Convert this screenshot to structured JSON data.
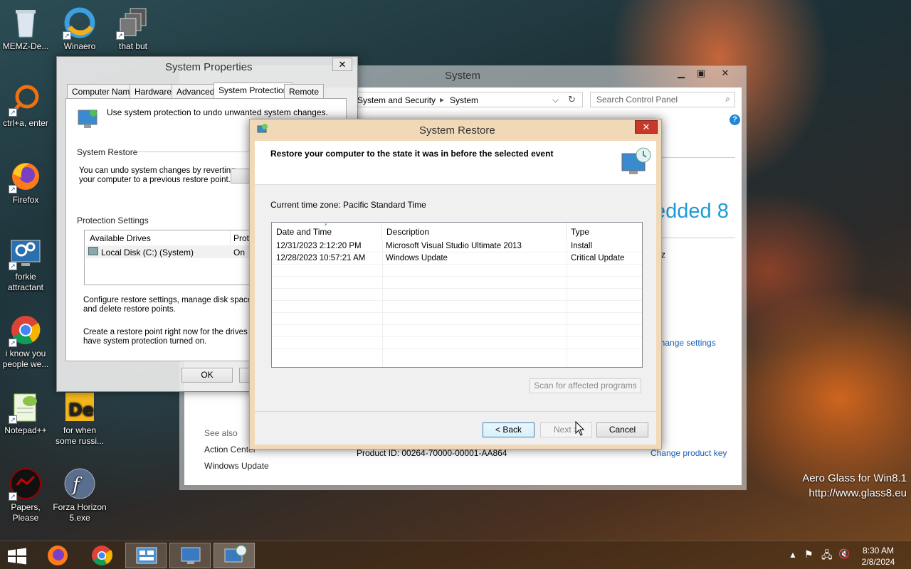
{
  "desktop": {
    "icons": [
      {
        "label": "MEMZ-De...",
        "icon": "recycle-bin-icon"
      },
      {
        "label": "Winaero Tweaker",
        "icon": "winaero-icon"
      },
      {
        "label": "that but ",
        "icon": "stack-icon"
      },
      {
        "label": "ctrl+a, enter",
        "icon": "orange-ring-icon"
      },
      {
        "label": "Firefox",
        "icon": "firefox-icon"
      },
      {
        "label": "forkie attractant",
        "icon": "gears-monitor-icon"
      },
      {
        "label": "i know you people we...",
        "icon": "chrome-icon"
      },
      {
        "label": "Notepad++",
        "icon": "notepadpp-icon"
      },
      {
        "label": "for when some russi...",
        "icon": "de-icon"
      },
      {
        "label": "Papers, Please",
        "icon": "papers-please-icon"
      },
      {
        "label": "Forza Horizon 5.exe",
        "icon": "flash-icon"
      }
    ],
    "watermark_line1": "Aero Glass for Win8.1",
    "watermark_line2": "http://www.glass8.eu"
  },
  "system_window": {
    "title": "System",
    "breadcrumb_1": "System and Security",
    "breadcrumb_sep": "▸",
    "breadcrumb_2": "System",
    "search_placeholder": "Search Control Panel",
    "edition_fragment": "edded 8",
    "z_fragment": "z",
    "change_settings": "Change settings",
    "see_also": "See also",
    "action_center": "Action Center",
    "windows_update": "Windows Update",
    "product_id": "Product ID:  00264-70000-00001-AA864",
    "change_product_key": "Change product key"
  },
  "properties_window": {
    "title": "System Properties",
    "tabs": [
      "Computer Name",
      "Hardware",
      "Advanced",
      "System Protection",
      "Remote"
    ],
    "intro": "Use system protection to undo unwanted system changes.",
    "restore_group": "System Restore",
    "restore_text_1": "You can undo system changes by reverting",
    "restore_text_2": "your computer to a previous restore point.",
    "protection_group": "Protection Settings",
    "col_drives": "Available Drives",
    "col_protection": "Prote",
    "drive_name": "Local Disk (C:) (System)",
    "drive_status": "On",
    "configure_text_1": "Configure restore settings, manage disk space,",
    "configure_text_2": "and delete restore points.",
    "create_text_1": "Create a restore point right now for the drives that",
    "create_text_2": "have system protection turned on.",
    "ok_label": "OK"
  },
  "restore_window": {
    "title": "System Restore",
    "heading": "Restore your computer to the state it was in before the selected event",
    "timezone": "Current time zone: Pacific Standard Time",
    "columns": [
      "Date and Time",
      "Description",
      "Type"
    ],
    "rows": [
      {
        "date": "12/31/2023 2:12:20 PM",
        "description": "Microsoft Visual Studio Ultimate 2013",
        "type": "Install"
      },
      {
        "date": "12/28/2023 10:57:21 AM",
        "description": "Windows Update",
        "type": "Critical Update"
      }
    ],
    "scan_label": "Scan for affected programs",
    "back_label": "< Back",
    "next_label": "Next >",
    "cancel_label": "Cancel"
  },
  "taskbar": {
    "time": "8:30 AM",
    "date": "2/8/2024"
  }
}
